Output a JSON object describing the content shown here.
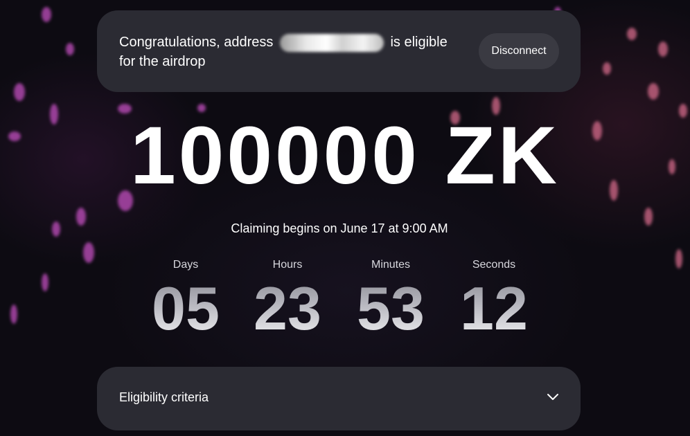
{
  "banner": {
    "message_prefix": "Congratulations, address",
    "message_suffix": "is eligible for the airdrop",
    "disconnect_label": "Disconnect"
  },
  "amount": "100000 ZK",
  "claim_info": "Claiming begins on June 17 at 9:00 AM",
  "countdown": {
    "days": {
      "label": "Days",
      "value": "05"
    },
    "hours": {
      "label": "Hours",
      "value": "23"
    },
    "minutes": {
      "label": "Minutes",
      "value": "53"
    },
    "seconds": {
      "label": "Seconds",
      "value": "12"
    }
  },
  "criteria": {
    "label": "Eligibility criteria",
    "icon": "chevron-down-icon"
  },
  "colors": {
    "card": "#2b2b33",
    "button": "#3a3a42",
    "background": "#0d0b12",
    "firework_purple": "#c24fbf",
    "firework_pink": "#d46a8a"
  }
}
